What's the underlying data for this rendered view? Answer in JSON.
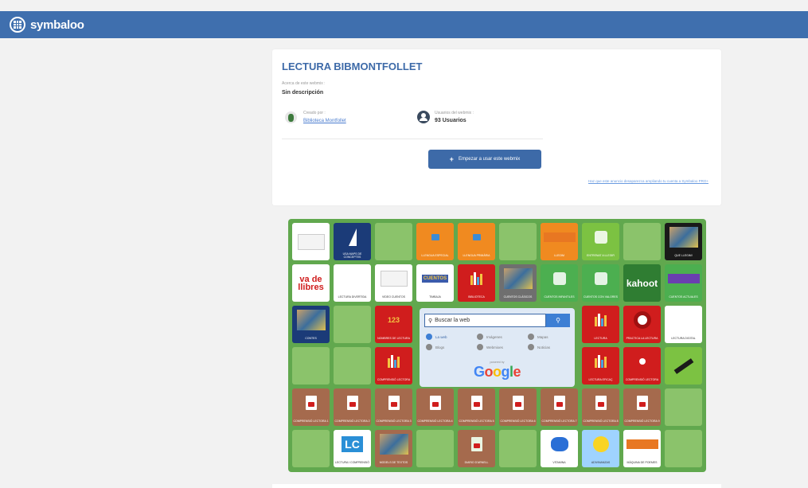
{
  "header": {
    "brand": "symbaloo",
    "logo_icon": "symbaloo-logo-icon",
    "color": "#3f6fae"
  },
  "card": {
    "title": "LECTURA BIBMONTFOLLET",
    "desc_label": "Acerca de este webmix :",
    "desc_value": "Sin descripción",
    "creator_label": "Creado por :",
    "creator_name": "Biblioteca Montfollet",
    "users_label": "Usuarios del webmix :",
    "users_value": "93 Usuarios",
    "start_button": "Empezar a usar este webmix",
    "start_icon": "+",
    "pro_link": "Haz que este anuncio desaparezca ampliando tu cuenta a Symbaloo PRO+"
  },
  "webmix": {
    "accent": "#61a84e",
    "tiles": [
      {
        "label": "",
        "icon": "dic-logo"
      },
      {
        "label": "USA MAPS DE CONCEPTES",
        "icon": "sailboat-icon"
      },
      {
        "label": "",
        "icon": ""
      },
      {
        "label": "LLENGUA ESPECIAL",
        "icon": "book-icon"
      },
      {
        "label": "LLENGUA PRIMÀRIA",
        "icon": "book-icon"
      },
      {
        "label": "",
        "icon": ""
      },
      {
        "label": "LLEGIM",
        "icon": "orange-banner-icon"
      },
      {
        "label": "ENTRENAT A LLEGIR",
        "icon": "green-character-icon"
      },
      {
        "label": "",
        "icon": ""
      },
      {
        "label": "QUE LLEGIM!",
        "icon": "reading-icon"
      },
      {
        "label": "",
        "icon": "vade-icon",
        "text": "va de llibres"
      },
      {
        "label": "LECTURA DIVERTIDA",
        "icon": ""
      },
      {
        "label": "VIDEO CUENTOS",
        "icon": "web-thumb-icon"
      },
      {
        "label": "TIMBAJA",
        "icon": "cuentos-icon",
        "text": "CUENTOS"
      },
      {
        "label": "BIBLIOTECA",
        "icon": "books-icon"
      },
      {
        "label": "CUENTOS CLÁSICOS",
        "icon": "photo-icon"
      },
      {
        "label": "CUENTOS INFANTILES",
        "icon": "sparkle-icon"
      },
      {
        "label": "CUENTOS CON VALORES",
        "icon": "cuentos-logo-icon"
      },
      {
        "label": "",
        "icon": "kahoot-icon",
        "text": "kahoot"
      },
      {
        "label": "CUENTOS ACTUALES",
        "icon": "purple-banner-icon"
      },
      {
        "label": "CONTES",
        "icon": "map-icon"
      },
      {
        "label": "",
        "icon": ""
      },
      {
        "label": "NOMBRES DE LECTURA",
        "icon": "num-icon",
        "text": "123"
      },
      {
        "label": "",
        "icon": "search-widget"
      },
      {
        "label": "",
        "icon": "search-widget"
      },
      {
        "label": "",
        "icon": "search-widget"
      },
      {
        "label": "",
        "icon": "search-widget"
      },
      {
        "label": "LECTURA",
        "icon": "books-icon"
      },
      {
        "label": "PRACTICA LA LECTURA",
        "icon": "red-swirl-icon"
      },
      {
        "label": "LECTURA DIGITAL",
        "icon": ""
      },
      {
        "label": "",
        "icon": ""
      },
      {
        "label": "",
        "icon": ""
      },
      {
        "label": "COMPRENSIÓ LECTORA",
        "icon": "books-icon"
      },
      {
        "label": "",
        "icon": "search-widget"
      },
      {
        "label": "",
        "icon": "search-widget"
      },
      {
        "label": "",
        "icon": "search-widget"
      },
      {
        "label": "",
        "icon": "search-widget"
      },
      {
        "label": "LECTURA EFICAÇ",
        "icon": "books-icon"
      },
      {
        "label": "COMPRENSIÓ LECTORA",
        "icon": "dot-icon"
      },
      {
        "label": "",
        "icon": "lime-pencil-icon"
      },
      {
        "label": "COMPRENSIÓ LECTORA 1",
        "icon": "doc-icon"
      },
      {
        "label": "COMPRENSIÓ LECTORA 2",
        "icon": "doc-icon"
      },
      {
        "label": "COMPRENSIÓ LECTORA 3",
        "icon": "doc-icon"
      },
      {
        "label": "COMPRENSIÓ LECTORA 4",
        "icon": "doc-icon"
      },
      {
        "label": "COMPRENSIÓ LECTORA 5",
        "icon": "doc-icon"
      },
      {
        "label": "COMPRENSIÓ LECTORA 6",
        "icon": "doc-icon"
      },
      {
        "label": "COMPRENSIÓ LECTORA 7",
        "icon": "doc-icon"
      },
      {
        "label": "COMPRENSIÓ LECTORA 8",
        "icon": "doc-icon"
      },
      {
        "label": "COMPRENSIÓ LECTORA 9",
        "icon": "doc-icon"
      },
      {
        "label": "",
        "icon": ""
      },
      {
        "label": "",
        "icon": ""
      },
      {
        "label": "LECTURA I COMPRENSIÓ",
        "icon": "lc-icon",
        "text": "LC"
      },
      {
        "label": "MODELS DE TEXTOS",
        "icon": "collage-icon"
      },
      {
        "label": "",
        "icon": ""
      },
      {
        "label": "DIARIO D'ARNELL",
        "icon": "green-doc-icon"
      },
      {
        "label": "",
        "icon": ""
      },
      {
        "label": "VITAMINA",
        "icon": "splash-icon"
      },
      {
        "label": "ADIVINANZAS",
        "icon": "sun-icon"
      },
      {
        "label": "MÀQUINA DE POEMES",
        "icon": "orange-bar-icon"
      },
      {
        "label": "",
        "icon": ""
      }
    ]
  },
  "search_widget": {
    "placeholder": "Buscar la web",
    "button_icon": "search-icon",
    "engines": [
      "La web",
      "Imágenes",
      "Mapas",
      "Blogs",
      "Webmixes",
      "Noticias"
    ],
    "active_engine": "La web",
    "powered": "powered by",
    "provider": "Google"
  }
}
